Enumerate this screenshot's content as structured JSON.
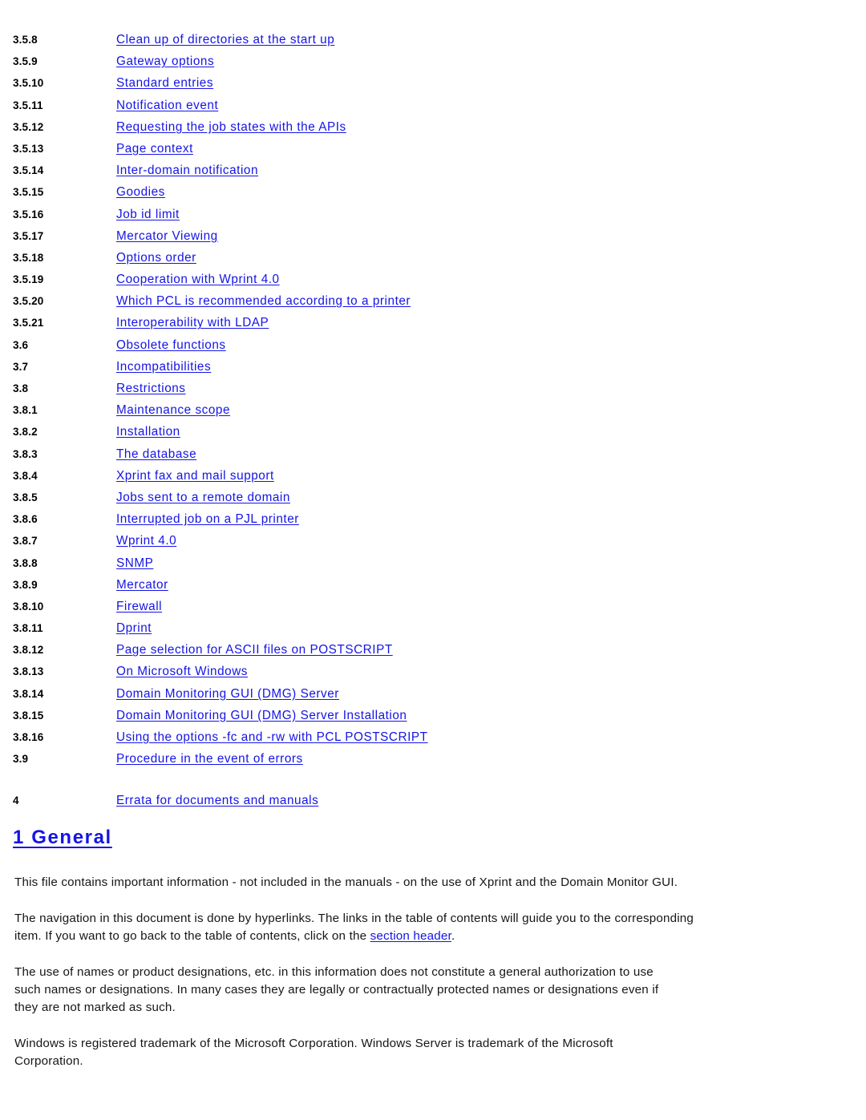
{
  "document": {
    "link_color": "#1414E6",
    "text_color": "#161616",
    "background_color": "#FFFFFF"
  },
  "toc": {
    "entries": [
      {
        "number": "3.5.8",
        "title": "Clean up of directories at the start up",
        "gap_before": false
      },
      {
        "number": "3.5.9",
        "title": "Gateway options",
        "gap_before": false
      },
      {
        "number": "3.5.10",
        "title": "Standard entries",
        "gap_before": false
      },
      {
        "number": "3.5.11",
        "title": "Notification event",
        "gap_before": false
      },
      {
        "number": "3.5.12",
        "title": "Requesting the job states with the APIs",
        "gap_before": false
      },
      {
        "number": "3.5.13",
        "title": "Page context",
        "gap_before": false
      },
      {
        "number": "3.5.14",
        "title": "Inter-domain notification",
        "gap_before": false
      },
      {
        "number": "3.5.15",
        "title": "Goodies",
        "gap_before": false
      },
      {
        "number": "3.5.16",
        "title": "Job id limit",
        "gap_before": false
      },
      {
        "number": "3.5.17",
        "title": "Mercator Viewing",
        "gap_before": false
      },
      {
        "number": "3.5.18",
        "title": "Options order",
        "gap_before": false
      },
      {
        "number": "3.5.19",
        "title": "Cooperation with Wprint 4.0",
        "gap_before": false
      },
      {
        "number": "3.5.20",
        "title": "Which PCL is recommended according to a printer",
        "gap_before": false
      },
      {
        "number": "3.5.21",
        "title": "Interoperability with LDAP",
        "gap_before": false
      },
      {
        "number": "3.6",
        "title": "Obsolete functions",
        "gap_before": false
      },
      {
        "number": "3.7",
        "title": "Incompatibilities",
        "gap_before": false
      },
      {
        "number": "3.8",
        "title": "Restrictions",
        "gap_before": false
      },
      {
        "number": "3.8.1",
        "title": "Maintenance scope",
        "gap_before": false
      },
      {
        "number": "3.8.2",
        "title": "Installation",
        "gap_before": false
      },
      {
        "number": "3.8.3",
        "title": "The database",
        "gap_before": false
      },
      {
        "number": "3.8.4",
        "title": "Xprint fax and mail support",
        "gap_before": false
      },
      {
        "number": "3.8.5",
        "title": "Jobs sent to a remote domain",
        "gap_before": false
      },
      {
        "number": "3.8.6",
        "title": "Interrupted job on a PJL printer",
        "gap_before": false
      },
      {
        "number": "3.8.7",
        "title": "Wprint 4.0",
        "gap_before": false
      },
      {
        "number": "3.8.8",
        "title": "SNMP",
        "gap_before": false
      },
      {
        "number": "3.8.9",
        "title": "Mercator",
        "gap_before": false
      },
      {
        "number": "3.8.10",
        "title": "Firewall",
        "gap_before": false
      },
      {
        "number": "3.8.11",
        "title": "Dprint",
        "gap_before": false
      },
      {
        "number": "3.8.12",
        "title": "Page selection for ASCII files on POSTSCRIPT",
        "gap_before": false
      },
      {
        "number": "3.8.13",
        "title": "On Microsoft Windows",
        "gap_before": false
      },
      {
        "number": "3.8.14",
        "title": "Domain Monitoring GUI (DMG) Server",
        "gap_before": false
      },
      {
        "number": "3.8.15",
        "title": "Domain Monitoring GUI (DMG) Server Installation",
        "gap_before": false
      },
      {
        "number": "3.8.16",
        "title": "Using the options -fc and -rw with PCL POSTSCRIPT",
        "gap_before": false
      },
      {
        "number": "3.9",
        "title": "Procedure in the event of errors",
        "gap_before": false
      },
      {
        "number": "4",
        "title": "Errata for documents and manuals",
        "gap_before": true
      }
    ]
  },
  "section": {
    "heading": "1 General"
  },
  "paragraphs": {
    "p1": "This file contains important information - not included in the manuals - on the use of Xprint and the Domain Monitor GUI.",
    "p2_before_link": "The navigation in this document is done by hyperlinks. The links in the table of contents will guide you to the corresponding item. If you want to go back to the table of contents, click on the ",
    "p2_link": "section header",
    "p2_after_link": ".",
    "p3": "The use of names or product designations, etc. in this information does not constitute a general authorization to use such names or designations. In many cases they are legally or contractually protected names or designations even if they are not marked as such.",
    "p4": "Windows is registered trademark of the Microsoft Corporation. Windows Server is trademark of the Microsoft Corporation."
  }
}
